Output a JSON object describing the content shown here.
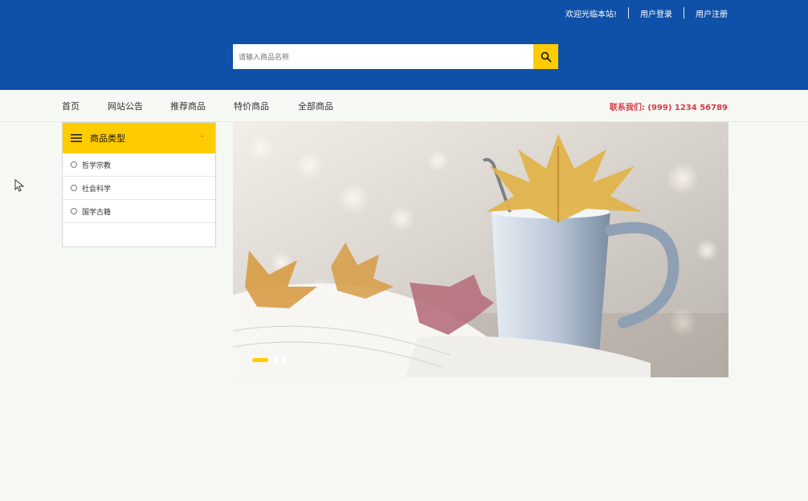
{
  "header": {
    "welcome": "欢迎光临本站!",
    "login": "用户登录",
    "register": "用户注册"
  },
  "search": {
    "placeholder": "请输入商品名称"
  },
  "nav": {
    "items": [
      "首页",
      "网站公告",
      "推荐商品",
      "特价商品",
      "全部商品"
    ],
    "contact": "联系我们: (999) 1234 56789"
  },
  "category": {
    "title": "商品类型",
    "items": [
      "哲学宗教",
      "社会科学",
      "国学古籍"
    ]
  },
  "colors": {
    "header_bg": "#0f51a8",
    "accent": "#ffcc00",
    "contact": "#d83b4a"
  },
  "carousel": {
    "active_index": 0,
    "total": 3
  }
}
